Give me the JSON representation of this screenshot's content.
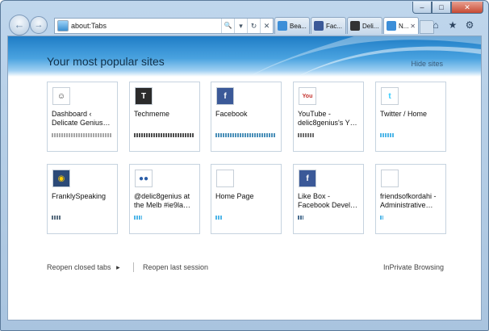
{
  "window": {
    "caption": {
      "minimize": "–",
      "maximize": "□",
      "close": "✕"
    }
  },
  "nav": {
    "back_glyph": "←",
    "forward_glyph": "→",
    "address": "about:Tabs",
    "addr_buttons": {
      "search": "🔍",
      "dropdown": "▾",
      "refresh": "↻",
      "stop": "✕"
    }
  },
  "tabs": [
    {
      "label": "Bea...",
      "icon": "ie-page-icon",
      "color": "#3c8ed8",
      "active": false
    },
    {
      "label": "Fac...",
      "icon": "facebook-icon",
      "color": "#3b5998",
      "active": false
    },
    {
      "label": "Deli...",
      "icon": "github-icon",
      "color": "#333333",
      "active": false
    },
    {
      "label": "N...",
      "icon": "ie-page-icon",
      "color": "#3c8ed8",
      "active": true,
      "close": "✕"
    }
  ],
  "commands": {
    "home": "⌂",
    "favorites": "★",
    "tools": "⚙"
  },
  "page": {
    "heading": "Your most popular sites",
    "hide": "Hide sites"
  },
  "tiles": [
    {
      "name": "Dashboard ‹ Delicate Genius…",
      "icon": "avatar-icon",
      "icon_bg": "#ffffff",
      "icon_fg": "#333333",
      "glyph": "☺",
      "bar_color": "#a6a6a6",
      "activity": 1.0
    },
    {
      "name": "Techmeme",
      "icon": "techmeme-icon",
      "icon_bg": "#2b2b2b",
      "icon_fg": "#ffffff",
      "glyph": "T",
      "bar_color": "#4d4d4d",
      "activity": 1.0
    },
    {
      "name": "Facebook",
      "icon": "facebook-icon",
      "icon_bg": "#3b5998",
      "icon_fg": "#ffffff",
      "glyph": "f",
      "bar_color": "#4a8fb8",
      "activity": 1.0
    },
    {
      "name": "YouTube - delic8genius's Y…",
      "icon": "youtube-icon",
      "icon_bg": "#ffffff",
      "icon_fg": "#c4302b",
      "glyph": "You",
      "bar_color": "#6e6e6e",
      "activity": 0.27
    },
    {
      "name": "Twitter / Home",
      "icon": "twitter-icon",
      "icon_bg": "#ffffff",
      "icon_fg": "#33ccff",
      "glyph": "t",
      "bar_color": "#4fb6e8",
      "activity": 0.23
    },
    {
      "name": "FranklySpeaking",
      "icon": "camera-icon",
      "icon_bg": "#2c4a78",
      "icon_fg": "#ffcc00",
      "glyph": "◉",
      "bar_color": "#5a6e80",
      "activity": 0.15
    },
    {
      "name": "@delic8genius at the Melb #ie9la…",
      "icon": "blue-dots-icon",
      "icon_bg": "#ffffff",
      "icon_fg": "#2a5ea8",
      "glyph": "●●",
      "bar_color": "#4fb6e8",
      "activity": 0.13
    },
    {
      "name": "Home Page",
      "icon": "blank-page-icon",
      "icon_bg": "#ffffff",
      "icon_fg": "#ffffff",
      "glyph": "",
      "bar_color": "#4fb6e8",
      "activity": 0.11
    },
    {
      "name": "Like Box - Facebook Devel…",
      "icon": "facebook-icon",
      "icon_bg": "#3b5998",
      "icon_fg": "#ffffff",
      "glyph": "f",
      "bar_color": "#4a6e90",
      "activity": 0.09
    },
    {
      "name": "friendsofkordahi - Administrative…",
      "icon": "blank-page-icon",
      "icon_bg": "#ffffff",
      "icon_fg": "#ffffff",
      "glyph": "",
      "bar_color": "#4fb6e8",
      "activity": 0.05
    }
  ],
  "footer": {
    "reopen_closed": "Reopen closed tabs",
    "reopen_arrow": "▸",
    "reopen_last": "Reopen last session",
    "inprivate": "InPrivate Browsing"
  }
}
